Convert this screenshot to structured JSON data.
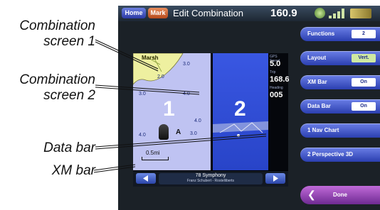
{
  "callouts": {
    "combination_screen_1": [
      "Combination",
      "screen 1"
    ],
    "combination_screen_2": [
      "Combination",
      "screen 2"
    ],
    "data_bar": "Data bar",
    "xm_bar": "XM bar"
  },
  "topbar": {
    "home_label": "Home",
    "mark_label": "Mark",
    "title": "Edit Combination",
    "speed": "160.9",
    "icons": [
      "gps-icon",
      "signal-icon",
      "battery-icon"
    ]
  },
  "screen": {
    "pane1_number": "1",
    "pane2_number": "2",
    "place_label": "Marsh",
    "depths": [
      "3.0",
      "2.0",
      "3.0",
      "4.0",
      "4.0",
      "4.0",
      "3.0"
    ],
    "nav_marker": "A",
    "scale": "0.5mi"
  },
  "databar": {
    "fields": [
      {
        "label": "GPS Speed",
        "value": "5.0"
      },
      {
        "label": "Trip",
        "value": "168.6"
      },
      {
        "label": "Heading",
        "value": "005"
      }
    ]
  },
  "xmbar": {
    "song": "78 Symphony",
    "artist": "Franz Schubert - Rostelliberts",
    "left_icon": "arrow-left-icon",
    "right_icon": "arrow-right-icon"
  },
  "side_menu": {
    "functions": {
      "label": "Functions",
      "value": "2"
    },
    "layout": {
      "label": "Layout",
      "value": "Vert."
    },
    "xm_bar": {
      "label": "XM Bar",
      "value": "On"
    },
    "data_bar": {
      "label": "Data Bar",
      "value": "On"
    },
    "nav_chart": {
      "label": "1 Nav Chart"
    },
    "perspective": {
      "label": "2 Perspective 3D"
    },
    "done": {
      "label": "Done"
    }
  },
  "colors": {
    "device_bg": "#1b2127",
    "button_blue": "#4a5fd0",
    "done_purple": "#9a48b8",
    "chart_land": "#eef0a0",
    "chart_water": "#bfc3f2",
    "perspective_water": "#3150d8"
  }
}
